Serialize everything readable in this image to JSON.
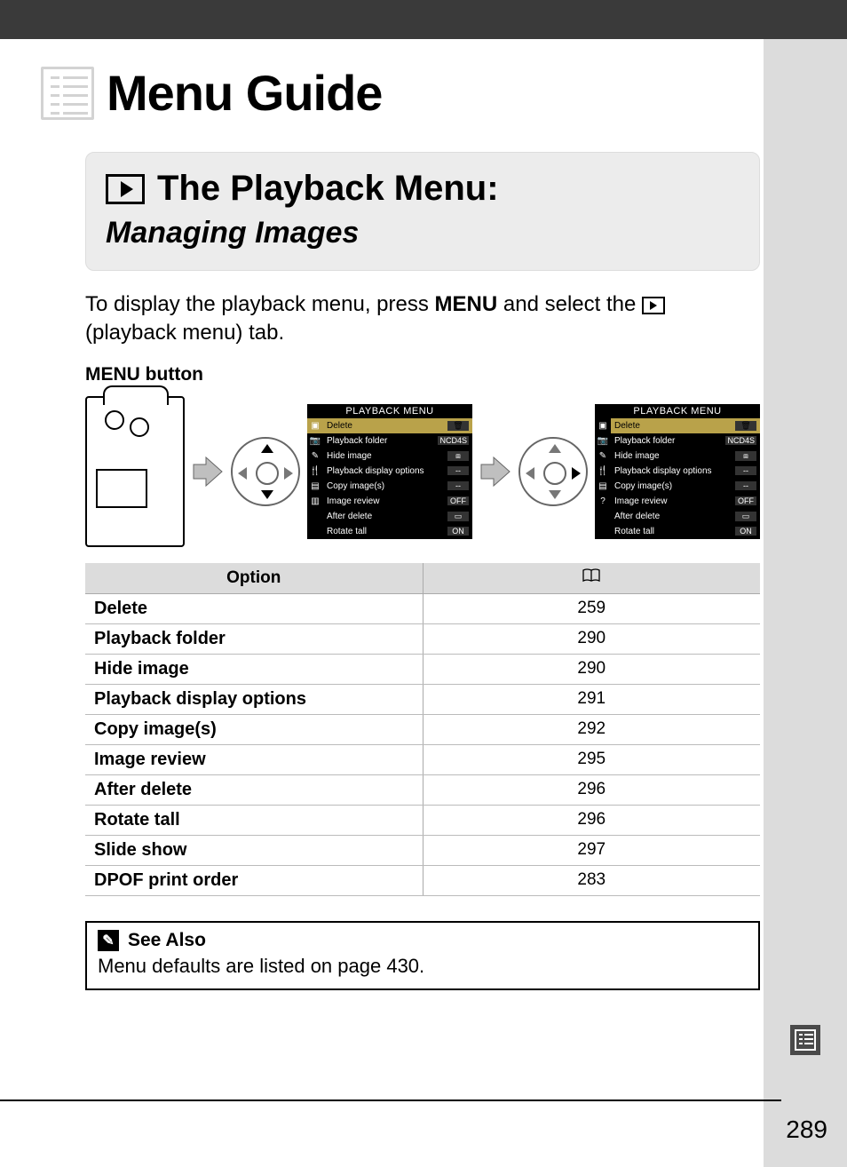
{
  "page_title": "Menu Guide",
  "section": {
    "heading": "The Playback Menu:",
    "subheading": "Managing Images"
  },
  "intro": {
    "line1_pre": "To display the playback menu, press ",
    "menu_kw": "MENU",
    "line1_mid": " and select the ",
    "line2": "(playback menu) tab."
  },
  "menu_button_label": {
    "kw": "MENU",
    "rest": " button"
  },
  "pbmenu": {
    "header": "PLAYBACK MENU",
    "items": [
      {
        "label": "Delete",
        "value": "🗑",
        "selected": true
      },
      {
        "label": "Playback folder",
        "value": "NCD4S",
        "selected": false
      },
      {
        "label": "Hide image",
        "value": "⧈",
        "selected": false
      },
      {
        "label": "Playback display options",
        "value": "--",
        "selected": false
      },
      {
        "label": "Copy image(s)",
        "value": "--",
        "selected": false
      },
      {
        "label": "Image review",
        "value": "OFF",
        "selected": false
      },
      {
        "label": "After delete",
        "value": "▭",
        "selected": false
      },
      {
        "label": "Rotate tall",
        "value": "ON",
        "selected": false
      }
    ]
  },
  "options_table": {
    "header_option": "Option",
    "header_page_icon": "📖",
    "rows": [
      {
        "option": "Delete",
        "page": "259"
      },
      {
        "option": "Playback folder",
        "page": "290"
      },
      {
        "option": "Hide image",
        "page": "290"
      },
      {
        "option": "Playback display options",
        "page": "291"
      },
      {
        "option": "Copy image(s)",
        "page": "292"
      },
      {
        "option": "Image review",
        "page": "295"
      },
      {
        "option": "After delete",
        "page": "296"
      },
      {
        "option": "Rotate tall",
        "page": "296"
      },
      {
        "option": "Slide show",
        "page": "297"
      },
      {
        "option": "DPOF print order",
        "page": "283"
      }
    ]
  },
  "see_also": {
    "heading": "See Also",
    "body": "Menu defaults are listed on page 430."
  },
  "page_number": "289"
}
